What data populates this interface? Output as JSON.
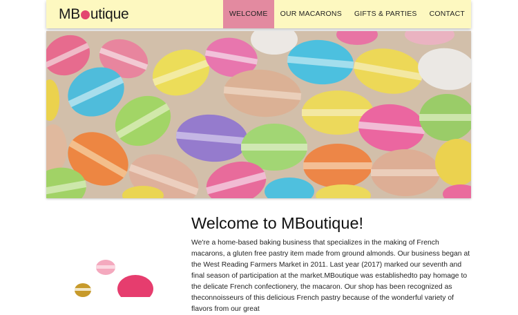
{
  "logo": {
    "left": "MB",
    "right": "utique"
  },
  "nav": [
    {
      "label": "WELCOME",
      "active": true
    },
    {
      "label": "OUR MACARONS",
      "active": false
    },
    {
      "label": "GIFTS & PARTIES",
      "active": false
    },
    {
      "label": "CONTACT",
      "active": false
    }
  ],
  "hero": {
    "image_icon": "macarons-photo"
  },
  "welcome": {
    "title": "Welcome to MBoutique!",
    "paragraph": "We're a home-based baking business that specializes in the making of French macarons, a gluten free pastry item made from ground almonds. Our business began at the West Reading Farmers Market in 2011. Last year (2017) marked our seventh and final season of participation at the market.MBoutique was establishedto pay homage to the delicate French confectionery, the macaron. Our shop has been recognized as theconnoisseurs of this delicious French pastry because of the wonderful variety of flavors from our great"
  },
  "colors": {
    "header_bg": "#fdf8c0",
    "nav_active": "#e38aa0",
    "accent": "#e3456f"
  }
}
